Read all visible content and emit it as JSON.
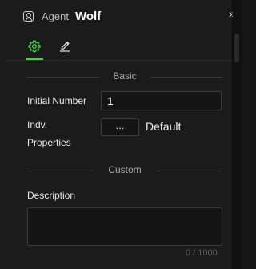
{
  "header": {
    "label": "Agent",
    "name": "Wolf",
    "icon": "agent-icon",
    "collapse_icon": "double-chevron-right-icon"
  },
  "tabs": [
    {
      "icon": "gear-icon",
      "active": true,
      "color": "#46d14f"
    },
    {
      "icon": "pencil-icon",
      "active": false
    }
  ],
  "sections": {
    "basic": {
      "title": "Basic",
      "initial_number_label": "Initial Number",
      "initial_number_value": "1",
      "indv_properties_label": "Indv. Properties",
      "indv_button_label": "...",
      "indv_value": "Default"
    },
    "custom": {
      "title": "Custom",
      "description_label": "Description",
      "description_value": "",
      "char_count": "0 / 1000"
    }
  }
}
